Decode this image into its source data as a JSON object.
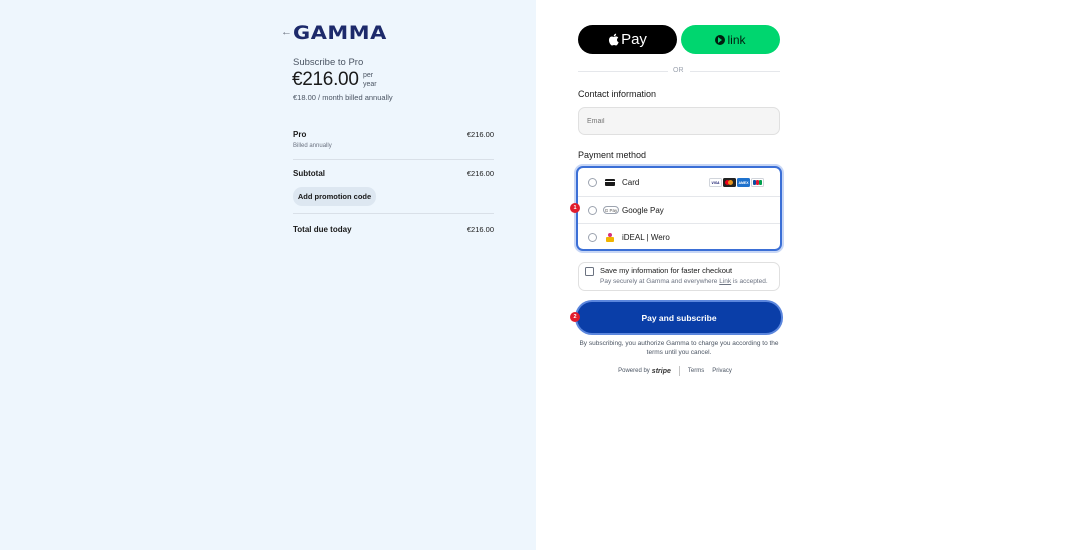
{
  "summary": {
    "back_icon": "arrow-left-icon",
    "logo_text": "GAMMA",
    "subscribe_to": "Subscribe to Pro",
    "price": "€216.00",
    "price_period_1": "per",
    "price_period_2": "year",
    "monthly_note": "€18.00 / month billed annually",
    "line_items": [
      {
        "label": "Pro",
        "sublabel": "Billed annually",
        "amount": "€216.00"
      }
    ],
    "subtotal_label": "Subtotal",
    "subtotal_amount": "€216.00",
    "promo_button": "Add promotion code",
    "total_label": "Total due today",
    "total_amount": "€216.00"
  },
  "checkout": {
    "apple_pay_label": "Pay",
    "link_label": "link",
    "or_text": "OR",
    "contact_label": "Contact information",
    "email_placeholder": "Email",
    "payment_label": "Payment method",
    "methods": [
      {
        "name": "Card",
        "icon": "card-icon"
      },
      {
        "name": "Google Pay",
        "icon": "google-pay-icon"
      },
      {
        "name": "iDEAL | Wero",
        "icon": "ideal-icon"
      }
    ],
    "card_brands": {
      "visa": "VISA",
      "amex": "AMEX"
    },
    "save_title": "Save my information for faster checkout",
    "save_sub_1": "Pay securely at Gamma and everywhere ",
    "save_sub_link": "Link",
    "save_sub_2": " is accepted.",
    "pay_button": "Pay and subscribe",
    "authorize_text": "By subscribing, you authorize Gamma to charge you according to the terms until you cancel.",
    "powered_by": "Powered by",
    "stripe": "stripe",
    "terms": "Terms",
    "privacy": "Privacy",
    "badges": [
      "1",
      "2"
    ]
  },
  "colors": {
    "left_bg": "#eef6fd",
    "accent": "#0a3ea8",
    "link_green": "#00d66f",
    "badge_red": "#e11d2e"
  }
}
